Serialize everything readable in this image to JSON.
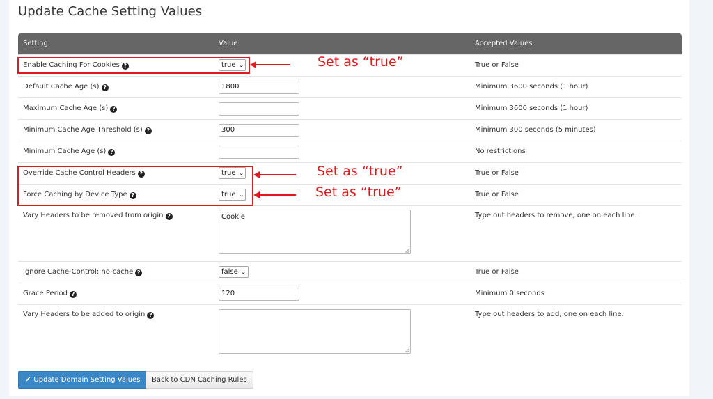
{
  "page": {
    "title": "Update Cache Setting Values"
  },
  "table": {
    "headers": {
      "setting": "Setting",
      "value": "Value",
      "accepted": "Accepted Values"
    },
    "rows": [
      {
        "label": "Enable Caching For Cookies",
        "type": "select",
        "value": "true",
        "accepted": "True or False"
      },
      {
        "label": "Default Cache Age (s)",
        "type": "text",
        "value": "1800",
        "accepted": "Minimum 3600 seconds (1 hour)"
      },
      {
        "label": "Maximum Cache Age (s)",
        "type": "text",
        "value": "",
        "accepted": "Minimum 3600 seconds (1 hour)"
      },
      {
        "label": "Minimum Cache Age Threshold (s)",
        "type": "text",
        "value": "300",
        "accepted": "Minimum 300 seconds (5 minutes)"
      },
      {
        "label": "Minimum Cache Age (s)",
        "type": "text",
        "value": "",
        "accepted": "No restrictions"
      },
      {
        "label": "Override Cache Control Headers",
        "type": "select",
        "value": "true",
        "accepted": "True or False"
      },
      {
        "label": "Force Caching by Device Type",
        "type": "select",
        "value": "true",
        "accepted": "True or False"
      },
      {
        "label": "Vary Headers to be removed from origin",
        "type": "textarea",
        "value": "Cookie",
        "accepted": "Type out headers to remove, one on each line."
      },
      {
        "label": "Ignore Cache-Control: no-cache",
        "type": "select",
        "value": "false",
        "accepted": "True or False"
      },
      {
        "label": "Grace Period",
        "type": "text",
        "value": "120",
        "accepted": "Minimum 0 seconds"
      },
      {
        "label": "Vary Headers to be added to origin",
        "type": "textarea",
        "value": "",
        "accepted": "Type out headers to add, one on each line."
      }
    ]
  },
  "icons": {
    "help": "?",
    "chevron_down": "⌄",
    "check": "✔"
  },
  "buttons": {
    "update": "Update Domain Setting Values",
    "back": "Back to CDN Caching Rules"
  },
  "annotations": [
    {
      "text": "Set as “true”"
    },
    {
      "text": "Set as “true”"
    },
    {
      "text": "Set as “true”"
    }
  ],
  "colors": {
    "header_bg": "#666666",
    "primary_button": "#3a87c8",
    "annotation_red": "#e0191e",
    "page_bg": "#f1f4f8"
  }
}
